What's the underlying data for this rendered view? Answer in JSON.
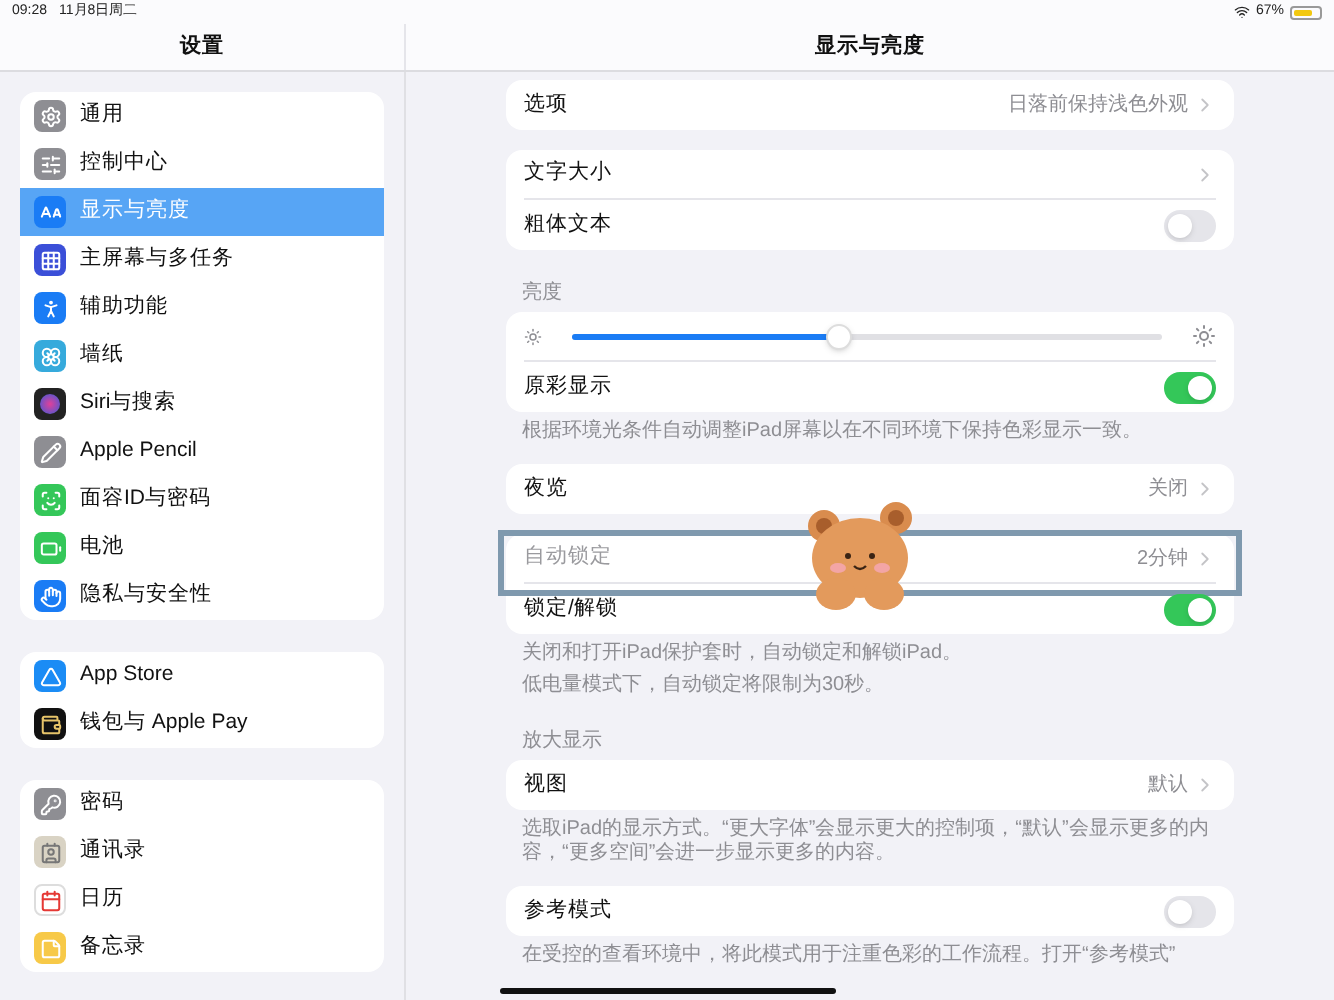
{
  "status_bar": {
    "time": "09:28",
    "date": "11月8日周二",
    "battery": "67%"
  },
  "sidebar": {
    "title": "设置",
    "groups": [
      [
        {
          "label": "通用",
          "selected": false
        },
        {
          "label": "控制中心",
          "selected": false
        },
        {
          "label": "显示与亮度",
          "selected": true
        },
        {
          "label": "主屏幕与多任务",
          "selected": false
        },
        {
          "label": "辅助功能",
          "selected": false
        },
        {
          "label": "墙纸",
          "selected": false
        },
        {
          "label": "Siri与搜索",
          "selected": false
        },
        {
          "label": "Apple Pencil",
          "selected": false
        },
        {
          "label": "面容ID与密码",
          "selected": false
        },
        {
          "label": "电池",
          "selected": false
        },
        {
          "label": "隐私与安全性",
          "selected": false
        }
      ],
      [
        {
          "label": "App Store",
          "selected": false
        },
        {
          "label": "钱包与 Apple Pay",
          "selected": false
        }
      ],
      [
        {
          "label": "密码",
          "selected": false
        },
        {
          "label": "通讯录",
          "selected": false
        },
        {
          "label": "日历",
          "selected": false
        },
        {
          "label": "备忘录",
          "selected": false
        }
      ]
    ]
  },
  "detail": {
    "title": "显示与亮度",
    "sections": [
      {
        "rows": [
          {
            "kind": "nav",
            "label": "选项",
            "value": "日落前保持浅色外观",
            "disabled": false,
            "highlighted": false
          }
        ]
      },
      {
        "rows": [
          {
            "kind": "nav",
            "label": "文字大小",
            "disabled": false,
            "highlighted": false
          },
          {
            "kind": "toggle",
            "label": "粗体文本",
            "on": false,
            "disabled": false,
            "highlighted": false
          }
        ]
      },
      {
        "header": "亮度",
        "rows": [
          {
            "kind": "slider",
            "level": 0.45
          },
          {
            "kind": "toggle",
            "label": "原彩显示",
            "on": true,
            "disabled": false,
            "highlighted": false
          }
        ],
        "footers": [
          "根据环境光条件自动调整iPad屏幕以在不同环境下保持色彩显示一致。"
        ]
      },
      {
        "rows": [
          {
            "kind": "nav",
            "label": "夜览",
            "value": "关闭",
            "disabled": false,
            "highlighted": false
          }
        ]
      },
      {
        "rows": [
          {
            "kind": "nav",
            "label": "自动锁定",
            "value": "2分钟",
            "disabled": true,
            "highlighted": true
          },
          {
            "kind": "toggle",
            "label": "锁定/解锁",
            "on": true,
            "disabled": false,
            "highlighted": false
          }
        ],
        "footers": [
          "关闭和打开iPad保护套时，自动锁定和解锁iPad。",
          "低电量模式下，自动锁定将限制为30秒。"
        ]
      },
      {
        "header": "放大显示",
        "rows": [
          {
            "kind": "nav",
            "label": "视图",
            "value": "默认",
            "disabled": false,
            "highlighted": false
          }
        ],
        "footers": [
          "选取iPad的显示方式。“更大字体”会显示更大的控制项，“默认”会显示更多的内容，“更多空间”会进一步显示更多的内容。"
        ]
      },
      {
        "rows": [
          {
            "kind": "toggle",
            "label": "参考模式",
            "on": false,
            "disabled": false,
            "highlighted": false
          }
        ],
        "footers": [
          "在受控的查看环境中，将此模式用于注重色彩的工作流程。打开“参考模式”"
        ]
      }
    ]
  }
}
